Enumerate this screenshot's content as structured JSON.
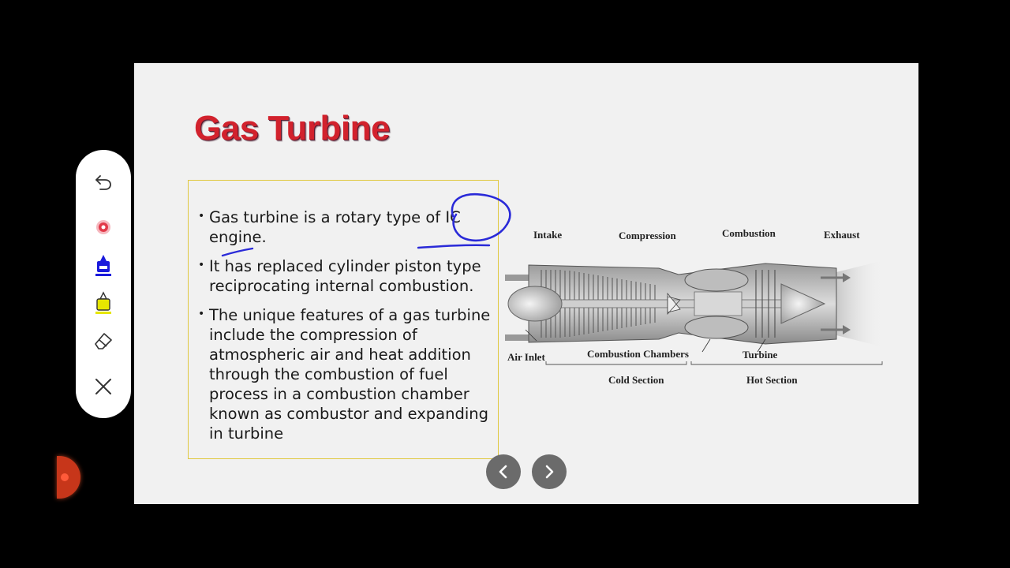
{
  "slide": {
    "title": "Gas Turbine",
    "bullets": [
      "Gas turbine is a rotary type of IC engine.",
      " It has replaced cylinder piston type reciprocating internal combustion.",
      "The unique features of a gas turbine include the compression of atmospheric air and heat addition through the combustion of fuel process in a combustion chamber known as combustor and expanding in turbine"
    ],
    "title_color": "#d2222d"
  },
  "diagram": {
    "labels": {
      "intake": "Intake",
      "compression": "Compression",
      "combustion": "Combustion",
      "exhaust": "Exhaust",
      "air_inlet": "Air Inlet",
      "combustion_chambers": "Combustion Chambers",
      "turbine": "Turbine",
      "cold_section": "Cold Section",
      "hot_section": "Hot Section"
    }
  },
  "navigation": {
    "prev_icon": "chevron-left-icon",
    "next_icon": "chevron-right-icon"
  },
  "toolbar": {
    "tools": [
      "undo-icon",
      "laser-pointer-icon",
      "pen-icon",
      "highlighter-icon",
      "eraser-icon",
      "close-icon"
    ],
    "pen_color": "#1a1adc",
    "highlighter_color": "#e6e600",
    "laser_color": "#e23a4a"
  },
  "annotation_color": "#2a2ad8"
}
